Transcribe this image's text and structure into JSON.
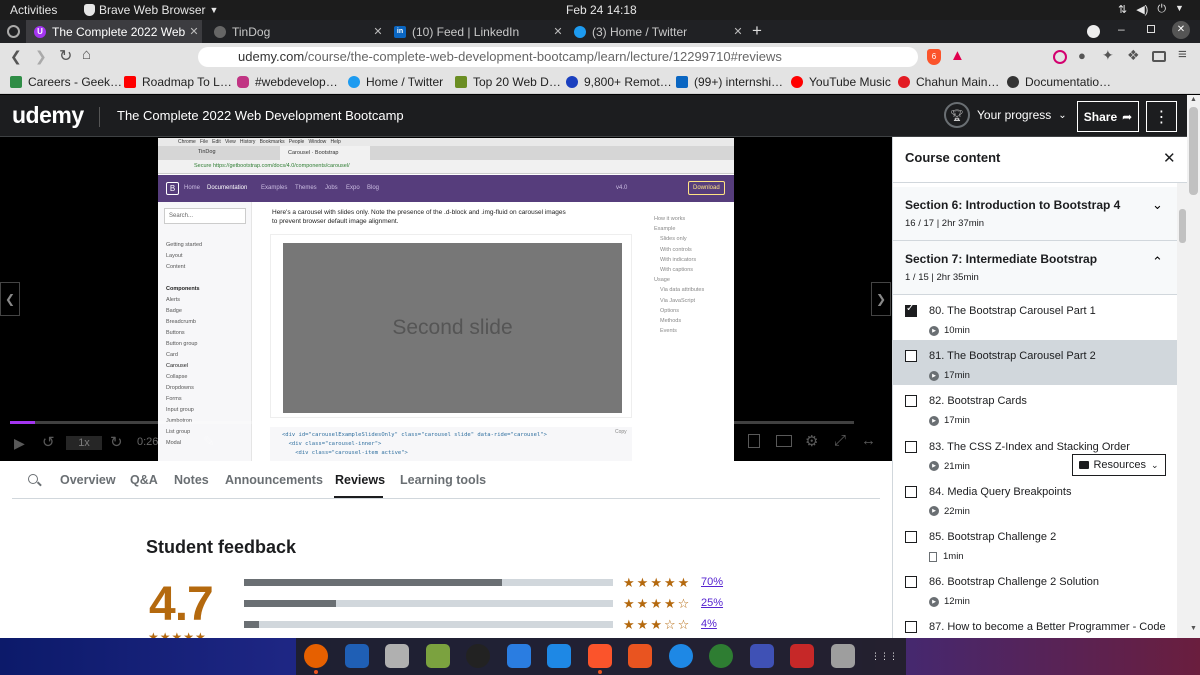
{
  "os": {
    "activities": "Activities",
    "app_name": "Brave Web Browser",
    "clock": "Feb 24  14:18"
  },
  "tabs": [
    {
      "title": "The Complete 2022 Web D",
      "active": true,
      "icon": "udemy-tab-icon"
    },
    {
      "title": "TinDog",
      "active": false,
      "icon": "globe-icon"
    },
    {
      "title": "(10) Feed | LinkedIn",
      "active": false,
      "icon": "linkedin-icon"
    },
    {
      "title": "(3) Home / Twitter",
      "active": false,
      "icon": "twitter-icon"
    }
  ],
  "address": {
    "host": "udemy.com",
    "path": "/course/the-complete-web-development-bootcamp/learn/lecture/12299710#reviews",
    "shield_count": "6"
  },
  "bookmarks": [
    {
      "label": "Careers - Geek…",
      "color": "#2f8d46"
    },
    {
      "label": "Roadmap To L…",
      "color": "#ff0000"
    },
    {
      "label": "#webdevelop…",
      "color": "#c13584"
    },
    {
      "label": "Home / Twitter",
      "color": "#1d9bf0"
    },
    {
      "label": "Top 20 Web D…",
      "color": "#6b8e23"
    },
    {
      "label": "9,800+ Remot…",
      "color": "#1a3fbf"
    },
    {
      "label": "(99+) internshi…",
      "color": "#0a66c2"
    },
    {
      "label": "YouTube Music",
      "color": "#ff0000"
    },
    {
      "label": "Chahun Main…",
      "color": "#e31b23"
    },
    {
      "label": "Documentatio…",
      "color": "#333333"
    }
  ],
  "udemy": {
    "logo": "udemy",
    "course_title": "The Complete 2022 Web Development Bootcamp",
    "progress_label": "Your progress",
    "share_label": "Share"
  },
  "video": {
    "slide_text": "Second slide",
    "speed": "1x",
    "time": "0:26",
    "browser_window": {
      "tab1": "TinDog",
      "tab2": "Carousel · Bootstrap",
      "url": "Secure  https://getbootstrap.com/docs/4.0/components/carousel/",
      "nav": [
        "Home",
        "Documentation",
        "Examples",
        "Themes",
        "Jobs",
        "Expo",
        "Blog"
      ],
      "version": "v4.0",
      "download": "Download",
      "search": "Search...",
      "intro": "Here's a carousel with slides only. Note the presence of the .d-block and .img-fluid on carousel images to prevent browser default image alignment.",
      "left_nav": [
        "Getting started",
        "Layout",
        "Content",
        "",
        "Components",
        "Alerts",
        "Badge",
        "Breadcrumb",
        "Buttons",
        "Button group",
        "Card",
        "Carousel",
        "Collapse",
        "Dropdowns",
        "Forms",
        "Input group",
        "Jumbotron",
        "List group",
        "Modal"
      ],
      "right_nav": [
        "How it works",
        "Example",
        "Slides only",
        "With controls",
        "With indicators",
        "With captions",
        "Usage",
        "Via data attributes",
        "Via JavaScript",
        "Options",
        "Methods",
        "Events"
      ],
      "code": [
        "<div id=\"carouselExampleSlidesOnly\" class=\"carousel slide\" data-ride=\"carousel\">",
        "  <div class=\"carousel-inner\">",
        "    <div class=\"carousel-item active\">"
      ],
      "copy": "Copy"
    }
  },
  "lower_tabs": [
    "Overview",
    "Q&A",
    "Notes",
    "Announcements",
    "Reviews",
    "Learning tools"
  ],
  "reviews": {
    "heading": "Student feedback",
    "rating": "4.7",
    "rows": [
      {
        "fraction": 0.7,
        "stars": 5,
        "pct": "70%"
      },
      {
        "fraction": 0.25,
        "stars": 4,
        "pct": "25%"
      },
      {
        "fraction": 0.04,
        "stars": 3,
        "pct": "4%"
      }
    ]
  },
  "course_content": {
    "title": "Course content",
    "sections": [
      {
        "title": "Section 6: Introduction to Bootstrap 4",
        "sub": "16 / 17 | 2hr 37min",
        "expanded": false
      },
      {
        "title": "Section 7: Intermediate Bootstrap",
        "sub": "1 / 15 | 2hr 35min",
        "expanded": true
      }
    ],
    "lectures": [
      {
        "title": "80. The Bootstrap Carousel Part 1",
        "duration": "10min",
        "done": true,
        "kind": "video",
        "current": false
      },
      {
        "title": "81. The Bootstrap Carousel Part 2",
        "duration": "17min",
        "done": false,
        "kind": "video",
        "current": true
      },
      {
        "title": "82. Bootstrap Cards",
        "duration": "17min",
        "done": false,
        "kind": "video",
        "current": false
      },
      {
        "title": "83. The CSS Z-Index and Stacking Order",
        "duration": "21min",
        "done": false,
        "kind": "video",
        "current": false
      },
      {
        "title": "84. Media Query Breakpoints",
        "duration": "22min",
        "done": false,
        "kind": "video",
        "current": false
      },
      {
        "title": "85. Bootstrap Challenge 2",
        "duration": "1min",
        "done": false,
        "kind": "file",
        "current": false
      },
      {
        "title": "86. Bootstrap Challenge 2 Solution",
        "duration": "12min",
        "done": false,
        "kind": "video",
        "current": false
      },
      {
        "title": "87. How to become a Better Programmer - Code",
        "duration": "",
        "done": false,
        "kind": "video",
        "current": false
      }
    ],
    "resources_label": "Resources"
  },
  "dock_apps": [
    "firefox-icon",
    "thunderbird-icon",
    "files-icon",
    "calculator-icon",
    "rhythmbox-icon",
    "writer-icon",
    "vscode-icon",
    "brave-icon",
    "software-icon",
    "help-icon",
    "globe-app-icon",
    "editor-icon",
    "screenshot-icon",
    "viewer-icon",
    "app-grid-icon"
  ]
}
